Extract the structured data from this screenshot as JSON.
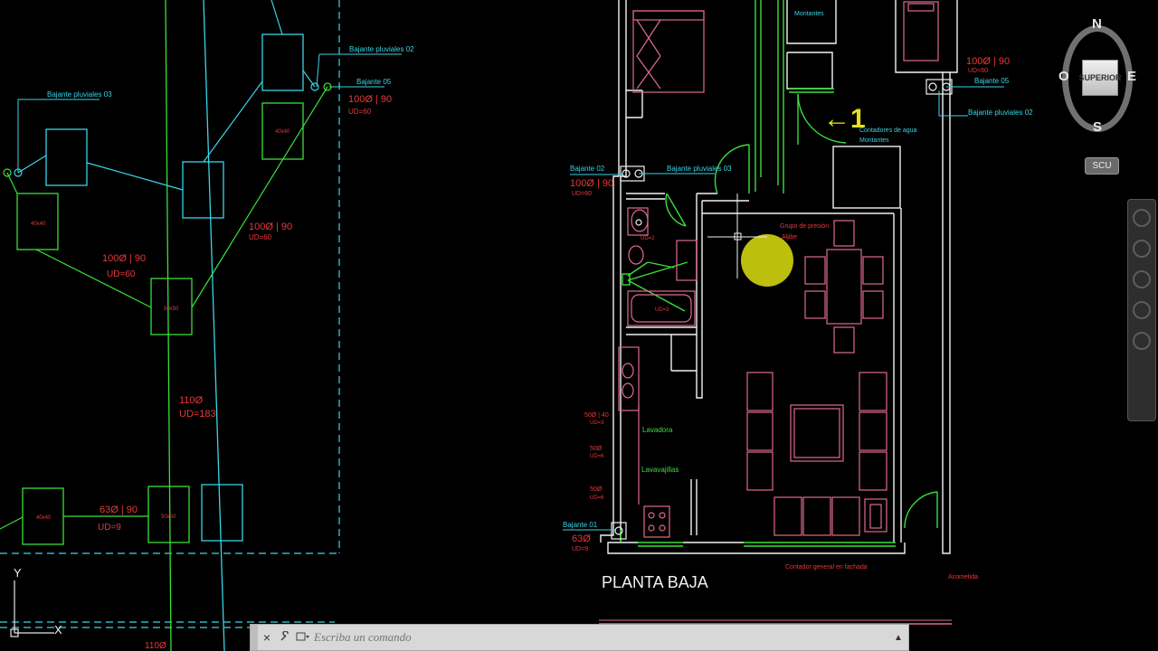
{
  "labels": {
    "bajante_pluviales_03_left": "Bajante pluviales 03",
    "bajante_pluviales_02_left": "Bajante pluviales 02",
    "bajante_05_left": "Bajante 05",
    "pipe_100_90_a": "100Ø | 90",
    "ud_60_a": "UD=60",
    "pipe_100_90_b": "100Ø | 90",
    "ud_60_b": "UD=60",
    "pipe_100_90_c": "100Ø | 90",
    "ud_60_c": "UD=60",
    "box_40x40_a": "40x40",
    "box_40x40_b": "40x40",
    "box_40x40_c": "40x40",
    "box_50x50_a": "50x50",
    "box_50x50_b": "50x50",
    "pipe_110": "110Ø",
    "ud_183": "UD=183",
    "pipe_63_90": "63Ø | 90",
    "ud_9": "UD=9",
    "pipe_110_bottom": "110Ø",
    "montantes_top": "Montantes",
    "pipe_100_90_right": "100Ø | 90",
    "ud_60_right": "UD=60",
    "bajante_05_right": "Bajante 05",
    "bajante_pluviales_02_right": "Bajante pluviales 02",
    "contadores_agua": "Contadores de agua",
    "montantes_mid": "Montantes",
    "bajante_02": "Bajante 02",
    "pipe_100_90_plan": "100Ø | 90",
    "ud_60_plan": "UD=60",
    "bajante_pluviales_03_right": "Bajante pluviales 03",
    "grupo_presion": "Grupo de presión",
    "aljibe": "Aljibe",
    "lavadora": "Lavadora",
    "lavavajillas": "Lavavajillas",
    "pipe_50_40": "50Ø | 40",
    "ud_3_a": "UD=3",
    "pipe_50_a": "50Ø",
    "ud_6_a": "UD=6",
    "pipe_50_b": "50Ø",
    "ud_6_b": "UD=6",
    "bajante_01": "Bajante 01",
    "pipe_63": "63Ø",
    "ud_9_plan": "UD=9",
    "ud_2": "UD=2",
    "ud_3_b": "UD=3",
    "contador_general": "Contador general en fachada",
    "acometida": "Acometida",
    "planta_baja": "PLANTA BAJA",
    "marker_arrow": "←1",
    "axis_y": "Y",
    "axis_x": "X"
  },
  "viewcube": {
    "face": "SUPERIOR",
    "north": "N",
    "south": "S",
    "east": "E",
    "west": "O",
    "wcs": "SCU"
  },
  "command_line": {
    "placeholder": "Escriba un comando",
    "close_icon": "×",
    "customize_icon": "wrench",
    "recent_icon": "▸",
    "up_icon": "▲"
  },
  "colors": {
    "background": "#000000",
    "pipe_green": "#3adf3a",
    "pipe_cyan": "#39d5e6",
    "text_red": "#e8383a",
    "furniture_pink": "#e06a8a",
    "wall_white": "#f2f2f2",
    "highlight_yellow": "#d7d90f"
  }
}
